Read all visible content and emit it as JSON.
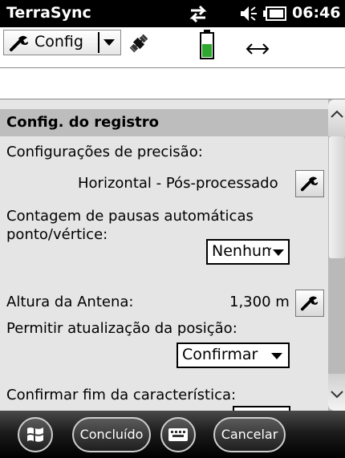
{
  "status_bar": {
    "app_title": "TerraSync",
    "time": "06:46",
    "icons": [
      "sync-arrows-icon",
      "speaker-icon",
      "battery-icon"
    ]
  },
  "toolbar": {
    "section_dropdown_label": "Config",
    "icons": [
      "satellite-icon",
      "receiver-battery-icon",
      "horizontal-arrows-icon"
    ]
  },
  "section": {
    "title": "Config. do registro"
  },
  "fields": {
    "precision_label": "Configurações de precisão:",
    "precision_value": "Horizontal - Pós-processado",
    "auto_pause_label": "Contagem de pausas automáticas ponto/vértice:",
    "auto_pause_label_line1": "Contagem de pausas automáticas",
    "auto_pause_label_line2": "ponto/vértice:",
    "auto_pause_value": "Nenhum",
    "antenna_label": "Altura da Antena:",
    "antenna_value": "1,300 m",
    "position_update_label": "Permitir atualização da posição:",
    "position_update_value": "Confirmar",
    "confirm_end_label": "Confirmar fim da característica:"
  },
  "bottom_bar": {
    "done_label": "Concluído",
    "cancel_label": "Cancelar",
    "icons": [
      "windows-start-icon",
      "keyboard-icon"
    ]
  },
  "colors": {
    "status_bar_bg": "#000000",
    "panel_bg": "#e5e5e5",
    "section_header_bg": "#bdbdbd",
    "bottom_bar_bg": "#1c1c1c",
    "battery_green": "#2ea82e"
  }
}
